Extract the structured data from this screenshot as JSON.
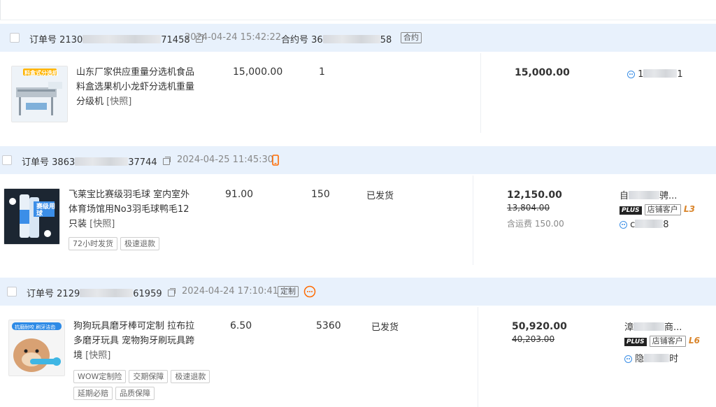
{
  "orders": [
    {
      "order_label": "订单号",
      "order_no_start": "2130",
      "order_no_end": "71458",
      "time": "2024-04-24 15:42:22",
      "contract_label": "合约号",
      "contract_no_start": "36",
      "contract_no_end": "58",
      "contract_tag": "合约",
      "product": {
        "title": "山东厂家供应重量分选机食品料盒选果机小龙虾分选机重量分级机",
        "snapshot": "[快照]",
        "thumb_text": "料盒式分选机"
      },
      "price": "15,000.00",
      "qty": "1",
      "status": "",
      "total": "15,000.00",
      "buyer_id_start": "1",
      "buyer_id_end": "1"
    },
    {
      "order_label": "订单号",
      "order_no_start": "3863",
      "order_no_end": "37744",
      "time": "2024-04-25 11:45:30",
      "product": {
        "title": "飞莱宝比赛级羽毛球 室内室外体育场馆用No3羽毛球鸭毛12只装",
        "snapshot": "[快照]",
        "thumb_text": "赛级用球",
        "tags": [
          "72小时发货",
          "极速退款"
        ]
      },
      "price": "91.00",
      "qty": "150",
      "status": "已发货",
      "total": "12,150.00",
      "orig_total": "13,804.00",
      "shipping": "含运费 150.00",
      "buyer_name_start": "自",
      "buyer_name_end": "骋...",
      "plus": "PLUS",
      "cust_tag": "店铺客户",
      "level": "L3",
      "buyer_id_start": "c",
      "buyer_id_end": "8"
    },
    {
      "order_label": "订单号",
      "order_no_start": "2129",
      "order_no_end": "61959",
      "time": "2024-04-24 17:10:41",
      "custom_tag": "定制",
      "product": {
        "title": "狗狗玩具磨牙棒可定制 拉布拉多磨牙玩具 宠物狗牙刷玩具跨境",
        "snapshot": "[快照]",
        "thumb_text": "抗磨耐咬 刷牙洁齿",
        "tags": [
          "WOW定制险",
          "交期保障",
          "极速退款",
          "延期必赔",
          "品质保障"
        ]
      },
      "price": "6.50",
      "qty": "5360",
      "status": "已发货",
      "total": "50,920.00",
      "orig_total": "40,203.00",
      "buyer_name_start": "漳",
      "buyer_name_end": "商...",
      "plus": "PLUS",
      "cust_tag": "店铺客户",
      "level": "L6",
      "buyer_id_start": "隐",
      "buyer_id_end": "时"
    }
  ]
}
